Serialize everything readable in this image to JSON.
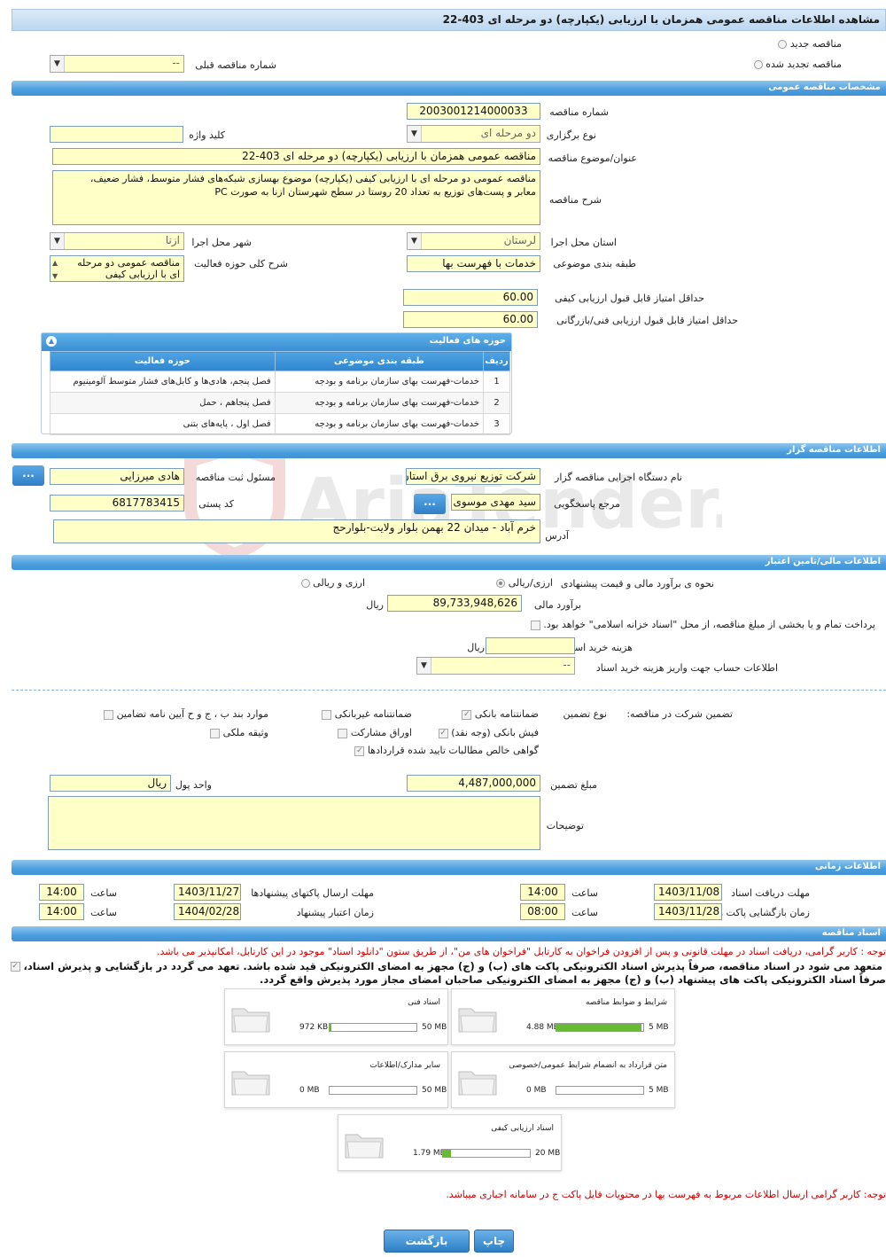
{
  "header": {
    "title": "مشاهده اطلاعات مناقصه عمومی همزمان با ارزیابی (یکپارچه) دو مرحله ای 403-22"
  },
  "top": {
    "new_label": "مناقصه جدید",
    "renewed_label": "مناقصه تجدید شده",
    "prev_label": "شماره مناقصه قبلی",
    "prev_value": "--"
  },
  "general": {
    "section_title": "مشخصات مناقصه عمومی",
    "number_label": "شماره مناقصه",
    "number_value": "2003001214000033",
    "type_label": "نوع برگزاری",
    "type_value": "دو مرحله ای",
    "keyword_label": "کلید واژه",
    "keyword_value": "",
    "subject_label": "عنوان/موضوع مناقصه",
    "subject_value": "مناقصه عمومی همزمان با ارزیابی (یکپارچه) دو مرحله ای 403-22",
    "desc_label": "شرح مناقصه",
    "desc_line1": "مناقصه عمومی دو مرحله ای با ارزیابی کیفی (یکپارچه) موضوع بهسازی شبکه‌های فشار متوسط، فشار ضعیف،",
    "desc_line2": "معابر و پست‌های توزیع به تعداد 20 روستا  در سطح شهرستان ازنا به صورت PC",
    "province_label": "استان محل اجرا",
    "province_value": "لرستان",
    "city_label": "شهر محل اجرا",
    "city_value": "ازنا",
    "category_label": "طبقه بندی موضوعی",
    "category_value": "خدمات با فهرست بها",
    "scope_label": "شرح کلی حوزه فعالیت",
    "scope_line1": "مناقصه عمومی دو مرحله",
    "scope_line2": "ای با ارزیابی کیفی",
    "min_quality_label": "حداقل امتیاز قابل قبول ارزیابی کیفی",
    "min_quality_value": "60.00",
    "min_tech_label": "حداقل امتیاز قابل قبول ارزیابی فنی/بازرگانی",
    "min_tech_value": "60.00"
  },
  "activity": {
    "title": "حوزه های فعالیت",
    "headers": [
      "ردیف",
      "طبقه بندی موضوعی",
      "حوزه فعالیت"
    ],
    "rows": [
      [
        "1",
        "خدمات-فهرست بهای سازمان برنامه و بودجه",
        "فصل پنجم، هادی‌ها و کابل‌های فشار متوسط آلومینیوم"
      ],
      [
        "2",
        "خدمات-فهرست بهای سازمان برنامه و بودجه",
        "فصل پنجاهم ، حمل"
      ],
      [
        "3",
        "خدمات-فهرست بهای سازمان برنامه و بودجه",
        "فصل اول ، پایه‌های بتنی"
      ]
    ]
  },
  "organizer": {
    "section_title": "اطلاعات مناقصه گزار",
    "org_label": "نام دستگاه اجرایی مناقصه گزار",
    "org_value": "شرکت توزیع نیروی برق استان لرستان",
    "resp_label": "مسئول ثبت مناقصه",
    "resp_value": "هادی میرزایی",
    "ref_label": "مرجع پاسخگویی",
    "ref_value": "سید مهدی موسوی",
    "postal_label": "کد پستی",
    "postal_value": "6817783415",
    "address_label": "آدرس",
    "address_value": "خرم آباد - میدان 22 بهمن بلوار ولایت-بلوارحج",
    "btn": "..."
  },
  "finance": {
    "section_title": "اطلاعات مالی/تامین اعتبار",
    "method_label": "نحوه ی برآورد مالی و قیمت پیشنهادی",
    "opt1": "ارزی/ریالی",
    "opt2": "ارزی و ریالی",
    "estimate_label": "برآورد مالی",
    "estimate_value": "89,733,948,626",
    "estimate_unit": "ریال",
    "treasury_text": "پرداخت تمام و یا بخشی از مبلغ مناقصه، از محل \"اسناد خزانه اسلامی\" خواهد بود.",
    "doc_cost_label": "هزینه خرید اسناد",
    "doc_cost_unit": "ریال",
    "doc_cost_value": "",
    "account_label": "اطلاعات حساب جهت واریز هزینه خرید اسناد",
    "account_value": "--"
  },
  "guarantee": {
    "label": "تضمین شرکت در مناقصه:",
    "type_label": "نوع تضمین",
    "opt_bank": "ضمانتنامه بانکی",
    "opt_nonbank": "ضمانتنامه غیربانکی",
    "opt_other": "موارد بند ب ، ج و ح آیین نامه تضامین",
    "opt_cash": "فیش بانکی (وجه نقد)",
    "opt_bonds": "اوراق مشارکت",
    "opt_property": "وثیقه ملکی",
    "opt_claims": "گواهی خالص مطالبات تایید شده قراردادها",
    "amount_label": "مبلغ تضمین",
    "amount_value": "4,487,000,000",
    "currency_label": "واحد پول",
    "currency_value": "ریال",
    "notes_label": "توضیحات"
  },
  "timing": {
    "section_title": "اطلاعات زمانی",
    "receive_label": "مهلت دریافت اسناد",
    "receive_date": "1403/11/08",
    "receive_time": "14:00",
    "send_label": "مهلت ارسال پاکتهای پیشنهادها",
    "send_date": "1403/11/27",
    "send_time": "14:00",
    "open_label": "زمان بازگشایی پاکت ها",
    "open_date": "1403/11/28",
    "open_time": "08:00",
    "validity_label": "زمان اعتبار پیشنهاد",
    "validity_date": "1404/02/28",
    "validity_time": "14:00",
    "time_label": "ساعت"
  },
  "docs": {
    "section_title": "اسناد مناقصه",
    "note1": "توجه : کاربر گرامی، دریافت اسناد در مهلت قانونی و پس از افزودن فراخوان به کارتابل \"فراخوان های من\"، از طریق ستون \"دانلود اسناد\" موجود در این کارتابل، امکانپذیر می باشد.",
    "commit_line1": "متعهد می شود در اسناد مناقصه، صرفاً پذیرش اسناد الکترونیکی پاکت های (ب) و (ج) مجهز به امضای الکترونیکی قید شده باشد. تعهد می گردد در بازگشایی و پذیرش اسناد،",
    "commit_line2": "صرفاً اسناد الکترونیکی پاکت های پیشنهاد (ب) و (ج) مجهز به امضای الکترونیکی صاحبان امضای مجاز مورد پذیرش واقع گردد.",
    "cards": [
      {
        "title": "شرایط و ضوابط مناقصه",
        "used": "4.88 MB",
        "max": "5 MB",
        "fill": 0.976
      },
      {
        "title": "اسناد فنی",
        "used": "972 KB",
        "max": "50 MB",
        "fill": 0.019
      },
      {
        "title": "متن قرارداد به انضمام شرایط عمومی/خصوصی",
        "used": "0 MB",
        "max": "5 MB",
        "fill": 0
      },
      {
        "title": "سایر مدارک/اطلاعات",
        "used": "0 MB",
        "max": "50 MB",
        "fill": 0
      },
      {
        "title": "اسناد ارزیابی کیفی",
        "used": "1.79 MB",
        "max": "20 MB",
        "fill": 0.09
      }
    ],
    "note2": "توجه: کاربر گرامی ارسال اطلاعات مربوط به فهرست بها در محتویات فایل پاکت ج در سامانه اجباری میباشد."
  },
  "actions": {
    "print": "چاپ",
    "back": "بازگشت"
  },
  "watermark": {
    "text": "AriaTender.neT"
  }
}
